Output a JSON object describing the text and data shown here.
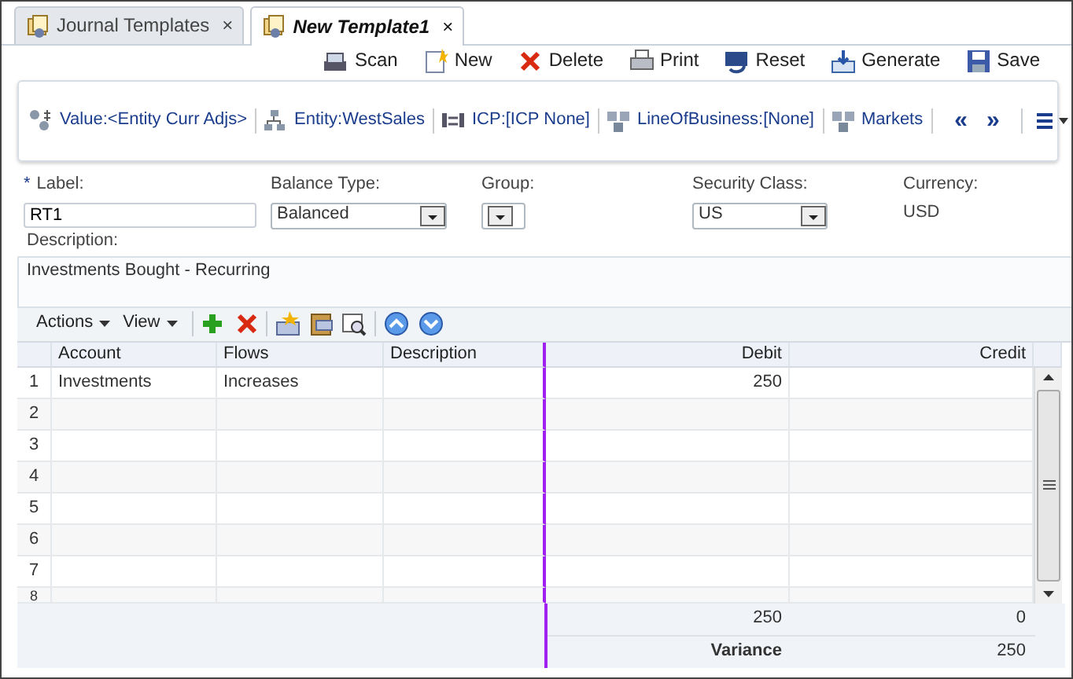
{
  "tabs": [
    {
      "label": "Journal Templates",
      "selected": false,
      "close": "×"
    },
    {
      "label": "New Template1",
      "selected": true,
      "close": "×"
    }
  ],
  "toolbar": [
    {
      "kind": "scan",
      "label": "Scan"
    },
    {
      "kind": "new",
      "label": "New"
    },
    {
      "kind": "delete",
      "label": "Delete"
    },
    {
      "kind": "print",
      "label": "Print"
    },
    {
      "kind": "reset",
      "label": "Reset"
    },
    {
      "kind": "generate",
      "label": "Generate"
    },
    {
      "kind": "save",
      "label": "Save"
    }
  ],
  "pov": {
    "items": [
      {
        "kind": "value",
        "label": "Value:<Entity Curr Adjs>"
      },
      {
        "kind": "entity",
        "label": "Entity:WestSales"
      },
      {
        "kind": "icp",
        "label": "ICP:[ICP None]"
      },
      {
        "kind": "dimension",
        "label": "LineOfBusiness:[None]"
      },
      {
        "kind": "dimension",
        "label": "Markets"
      }
    ],
    "prev": "«",
    "next": "»"
  },
  "form": {
    "label": {
      "required_mark": "*",
      "label": "Label:",
      "value": "RT1"
    },
    "balance_type": {
      "label": "Balance Type:",
      "value": "Balanced"
    },
    "group": {
      "label": "Group:"
    },
    "security_class": {
      "label": "Security Class:",
      "value": "US"
    },
    "currency": {
      "label": "Currency:",
      "value": "USD"
    },
    "description": {
      "label": "Description:",
      "value": "Investments Bought - Recurring"
    }
  },
  "grid_toolbar": {
    "menus": [
      "Actions",
      "View"
    ]
  },
  "grid": {
    "columns": [
      "Account",
      "Flows",
      "Description",
      "Debit",
      "Credit"
    ],
    "rows": [
      {
        "number": "1",
        "cells": [
          "Investments",
          "Increases",
          "",
          "250",
          ""
        ]
      },
      {
        "number": "2",
        "cells": [
          "",
          "",
          "",
          "",
          ""
        ]
      },
      {
        "number": "3",
        "cells": [
          "",
          "",
          "",
          "",
          ""
        ]
      },
      {
        "number": "4",
        "cells": [
          "",
          "",
          "",
          "",
          ""
        ]
      },
      {
        "number": "5",
        "cells": [
          "",
          "",
          "",
          "",
          ""
        ]
      },
      {
        "number": "6",
        "cells": [
          "",
          "",
          "",
          "",
          ""
        ]
      },
      {
        "number": "7",
        "cells": [
          "",
          "",
          "",
          "",
          ""
        ]
      },
      {
        "number": "8",
        "cells": [
          "",
          "",
          "",
          "",
          ""
        ]
      }
    ],
    "totals": {
      "debit": "250",
      "credit": "0"
    },
    "variance": {
      "label": "Variance",
      "value": "250"
    }
  }
}
